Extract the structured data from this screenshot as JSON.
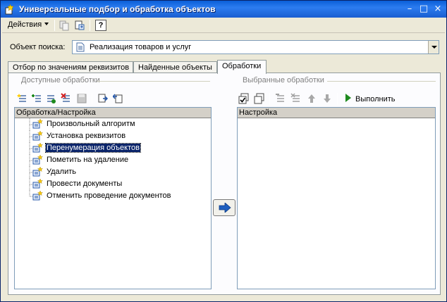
{
  "window": {
    "title": "Универсальные подбор и обработка объектов",
    "controls": {
      "minimize": "–",
      "maximize": "□",
      "close": "×"
    }
  },
  "toolbar": {
    "actions_label": "Действия",
    "help_label": "?"
  },
  "search": {
    "label": "Объект поиска:",
    "value": "Реализация товаров и услуг"
  },
  "tabs": [
    {
      "label": "Отбор по значениям реквизитов",
      "active": false
    },
    {
      "label": "Найденные объекты",
      "active": false
    },
    {
      "label": "Обработки",
      "active": true
    }
  ],
  "available": {
    "group_title": "Доступные обработки",
    "column_header": "Обработка/Настройка",
    "items": [
      {
        "label": "Произвольный алгоритм",
        "selected": false
      },
      {
        "label": "Установка реквизитов",
        "selected": false
      },
      {
        "label": "Перенумерация объектов",
        "selected": true
      },
      {
        "label": "Пометить на удаление",
        "selected": false
      },
      {
        "label": "Удалить",
        "selected": false
      },
      {
        "label": "Провести документы",
        "selected": false
      },
      {
        "label": "Отменить проведение документов",
        "selected": false
      }
    ]
  },
  "selected": {
    "group_title": "Выбранные обработки",
    "column_header": "Настройка",
    "run_label": "Выполнить"
  },
  "colors": {
    "title_bar": "#0a5fd8",
    "selection": "#0a246a",
    "window_bg": "#ece9d8",
    "run_green": "#1e8a1e",
    "move_arrow": "#1f5fbf"
  }
}
